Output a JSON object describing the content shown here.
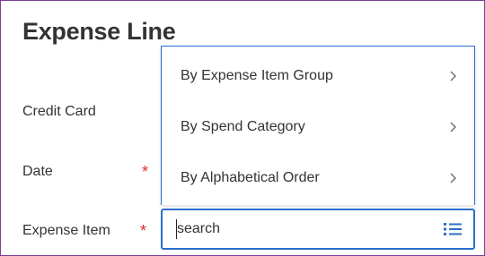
{
  "page": {
    "title": "Expense Line"
  },
  "fields": {
    "credit_card": {
      "label": "Credit Card"
    },
    "date": {
      "label": "Date",
      "required_mark": "*"
    },
    "expense_item": {
      "label": "Expense Item",
      "required_mark": "*"
    }
  },
  "menu": {
    "items": [
      {
        "label": "By Expense Item Group",
        "icon": "chevron-right-icon"
      },
      {
        "label": "By Spend Category",
        "icon": "chevron-right-icon"
      },
      {
        "label": "By Alphabetical Order",
        "icon": "chevron-right-icon"
      }
    ]
  },
  "search": {
    "placeholder": "search",
    "value": "",
    "icon": "list-icon"
  },
  "colors": {
    "accent": "#2a6fc9",
    "required": "#de2b2b",
    "frame_border": "#7b3f98",
    "text": "#333333"
  }
}
